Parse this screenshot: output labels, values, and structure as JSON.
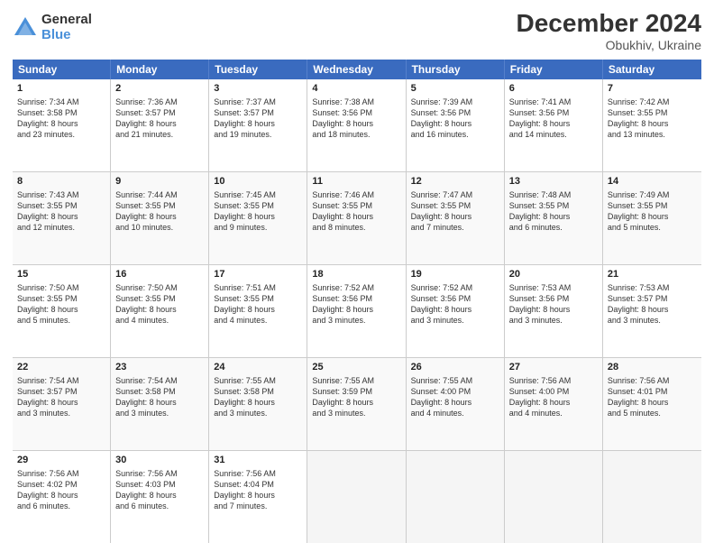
{
  "logo": {
    "general": "General",
    "blue": "Blue"
  },
  "header": {
    "month": "December 2024",
    "location": "Obukhiv, Ukraine"
  },
  "weekdays": [
    "Sunday",
    "Monday",
    "Tuesday",
    "Wednesday",
    "Thursday",
    "Friday",
    "Saturday"
  ],
  "rows": [
    [
      {
        "day": "1",
        "lines": [
          "Sunrise: 7:34 AM",
          "Sunset: 3:58 PM",
          "Daylight: 8 hours",
          "and 23 minutes."
        ]
      },
      {
        "day": "2",
        "lines": [
          "Sunrise: 7:36 AM",
          "Sunset: 3:57 PM",
          "Daylight: 8 hours",
          "and 21 minutes."
        ]
      },
      {
        "day": "3",
        "lines": [
          "Sunrise: 7:37 AM",
          "Sunset: 3:57 PM",
          "Daylight: 8 hours",
          "and 19 minutes."
        ]
      },
      {
        "day": "4",
        "lines": [
          "Sunrise: 7:38 AM",
          "Sunset: 3:56 PM",
          "Daylight: 8 hours",
          "and 18 minutes."
        ]
      },
      {
        "day": "5",
        "lines": [
          "Sunrise: 7:39 AM",
          "Sunset: 3:56 PM",
          "Daylight: 8 hours",
          "and 16 minutes."
        ]
      },
      {
        "day": "6",
        "lines": [
          "Sunrise: 7:41 AM",
          "Sunset: 3:56 PM",
          "Daylight: 8 hours",
          "and 14 minutes."
        ]
      },
      {
        "day": "7",
        "lines": [
          "Sunrise: 7:42 AM",
          "Sunset: 3:55 PM",
          "Daylight: 8 hours",
          "and 13 minutes."
        ]
      }
    ],
    [
      {
        "day": "8",
        "lines": [
          "Sunrise: 7:43 AM",
          "Sunset: 3:55 PM",
          "Daylight: 8 hours",
          "and 12 minutes."
        ]
      },
      {
        "day": "9",
        "lines": [
          "Sunrise: 7:44 AM",
          "Sunset: 3:55 PM",
          "Daylight: 8 hours",
          "and 10 minutes."
        ]
      },
      {
        "day": "10",
        "lines": [
          "Sunrise: 7:45 AM",
          "Sunset: 3:55 PM",
          "Daylight: 8 hours",
          "and 9 minutes."
        ]
      },
      {
        "day": "11",
        "lines": [
          "Sunrise: 7:46 AM",
          "Sunset: 3:55 PM",
          "Daylight: 8 hours",
          "and 8 minutes."
        ]
      },
      {
        "day": "12",
        "lines": [
          "Sunrise: 7:47 AM",
          "Sunset: 3:55 PM",
          "Daylight: 8 hours",
          "and 7 minutes."
        ]
      },
      {
        "day": "13",
        "lines": [
          "Sunrise: 7:48 AM",
          "Sunset: 3:55 PM",
          "Daylight: 8 hours",
          "and 6 minutes."
        ]
      },
      {
        "day": "14",
        "lines": [
          "Sunrise: 7:49 AM",
          "Sunset: 3:55 PM",
          "Daylight: 8 hours",
          "and 5 minutes."
        ]
      }
    ],
    [
      {
        "day": "15",
        "lines": [
          "Sunrise: 7:50 AM",
          "Sunset: 3:55 PM",
          "Daylight: 8 hours",
          "and 5 minutes."
        ]
      },
      {
        "day": "16",
        "lines": [
          "Sunrise: 7:50 AM",
          "Sunset: 3:55 PM",
          "Daylight: 8 hours",
          "and 4 minutes."
        ]
      },
      {
        "day": "17",
        "lines": [
          "Sunrise: 7:51 AM",
          "Sunset: 3:55 PM",
          "Daylight: 8 hours",
          "and 4 minutes."
        ]
      },
      {
        "day": "18",
        "lines": [
          "Sunrise: 7:52 AM",
          "Sunset: 3:56 PM",
          "Daylight: 8 hours",
          "and 3 minutes."
        ]
      },
      {
        "day": "19",
        "lines": [
          "Sunrise: 7:52 AM",
          "Sunset: 3:56 PM",
          "Daylight: 8 hours",
          "and 3 minutes."
        ]
      },
      {
        "day": "20",
        "lines": [
          "Sunrise: 7:53 AM",
          "Sunset: 3:56 PM",
          "Daylight: 8 hours",
          "and 3 minutes."
        ]
      },
      {
        "day": "21",
        "lines": [
          "Sunrise: 7:53 AM",
          "Sunset: 3:57 PM",
          "Daylight: 8 hours",
          "and 3 minutes."
        ]
      }
    ],
    [
      {
        "day": "22",
        "lines": [
          "Sunrise: 7:54 AM",
          "Sunset: 3:57 PM",
          "Daylight: 8 hours",
          "and 3 minutes."
        ]
      },
      {
        "day": "23",
        "lines": [
          "Sunrise: 7:54 AM",
          "Sunset: 3:58 PM",
          "Daylight: 8 hours",
          "and 3 minutes."
        ]
      },
      {
        "day": "24",
        "lines": [
          "Sunrise: 7:55 AM",
          "Sunset: 3:58 PM",
          "Daylight: 8 hours",
          "and 3 minutes."
        ]
      },
      {
        "day": "25",
        "lines": [
          "Sunrise: 7:55 AM",
          "Sunset: 3:59 PM",
          "Daylight: 8 hours",
          "and 3 minutes."
        ]
      },
      {
        "day": "26",
        "lines": [
          "Sunrise: 7:55 AM",
          "Sunset: 4:00 PM",
          "Daylight: 8 hours",
          "and 4 minutes."
        ]
      },
      {
        "day": "27",
        "lines": [
          "Sunrise: 7:56 AM",
          "Sunset: 4:00 PM",
          "Daylight: 8 hours",
          "and 4 minutes."
        ]
      },
      {
        "day": "28",
        "lines": [
          "Sunrise: 7:56 AM",
          "Sunset: 4:01 PM",
          "Daylight: 8 hours",
          "and 5 minutes."
        ]
      }
    ],
    [
      {
        "day": "29",
        "lines": [
          "Sunrise: 7:56 AM",
          "Sunset: 4:02 PM",
          "Daylight: 8 hours",
          "and 6 minutes."
        ]
      },
      {
        "day": "30",
        "lines": [
          "Sunrise: 7:56 AM",
          "Sunset: 4:03 PM",
          "Daylight: 8 hours",
          "and 6 minutes."
        ]
      },
      {
        "day": "31",
        "lines": [
          "Sunrise: 7:56 AM",
          "Sunset: 4:04 PM",
          "Daylight: 8 hours",
          "and 7 minutes."
        ]
      },
      {
        "day": "",
        "lines": []
      },
      {
        "day": "",
        "lines": []
      },
      {
        "day": "",
        "lines": []
      },
      {
        "day": "",
        "lines": []
      }
    ]
  ]
}
